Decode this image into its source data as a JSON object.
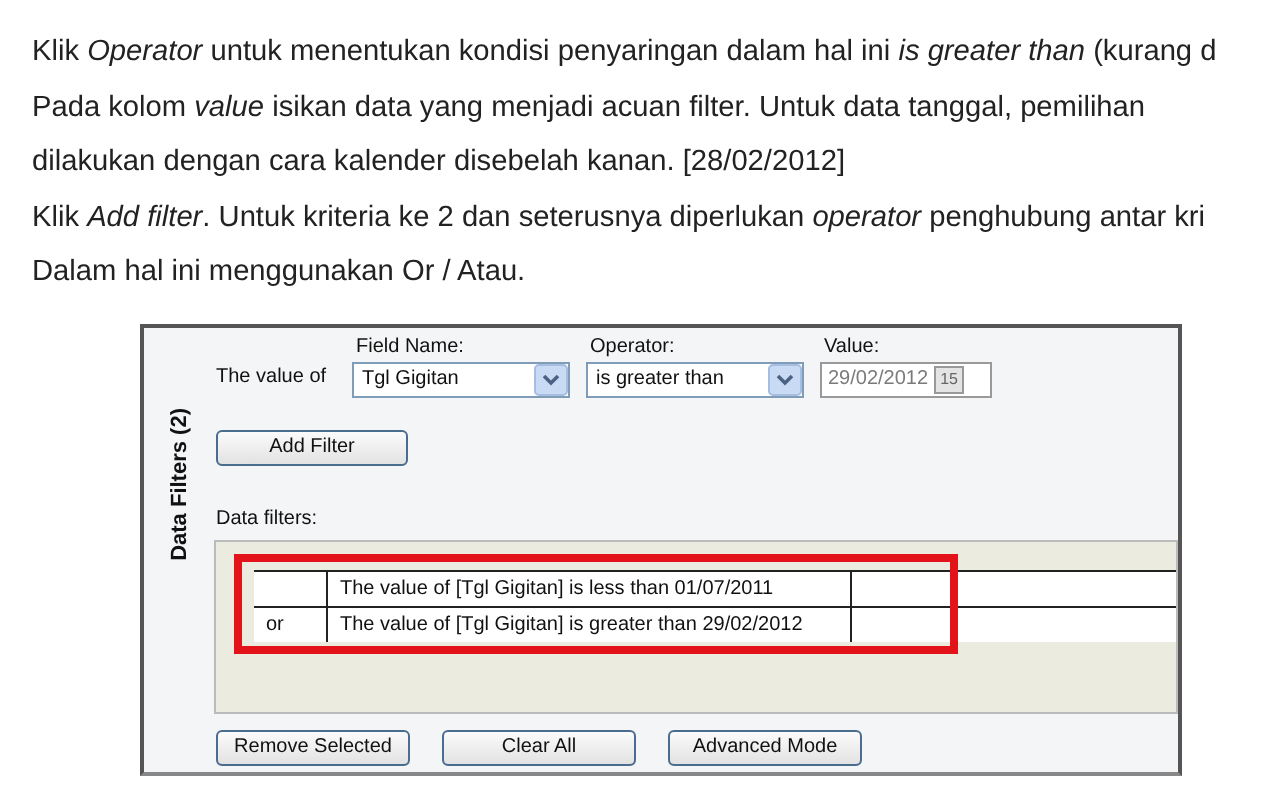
{
  "paragraphs": [
    {
      "text": "Klik *Operator* untuk menentukan kondisi penyaringan dalam hal ini *is greater than* (kurang d"
    },
    {
      "text": "Pada kolom *value* isikan data yang menjadi acuan filter. Untuk data tanggal, pemilihan"
    },
    {
      "text": "dilakukan dengan cara kalender disebelah kanan. [28/02/2012]"
    },
    {
      "text": "Klik *Add filter*. Untuk kriteria ke 2 dan seterusnya diperlukan *operator* penghubung antar kri"
    },
    {
      "text": "Dalam hal ini menggunakan Or / Atau."
    }
  ],
  "dialog": {
    "side_label": "Data Filters (2)",
    "row_label": "The value of",
    "field_name": {
      "label": "Field Name:",
      "value": "Tgl Gigitan"
    },
    "operator": {
      "label": "Operator:",
      "value": "is greater than"
    },
    "value": {
      "label": "Value:",
      "value": "29/02/2012",
      "disabled": true,
      "calendar": "15"
    },
    "add_button": "Add Filter",
    "list_label": "Data filters:",
    "rows": [
      {
        "criteria": "The value of [Tgl Gigitan] is less than 01/07/2011"
      },
      {
        "join": "or",
        "criteria": "The value of [Tgl Gigitan] is greater than 29/02/2012"
      }
    ],
    "highlight": true,
    "buttons": [
      "Remove Selected",
      "Clear All",
      "Advanced Mode"
    ]
  }
}
